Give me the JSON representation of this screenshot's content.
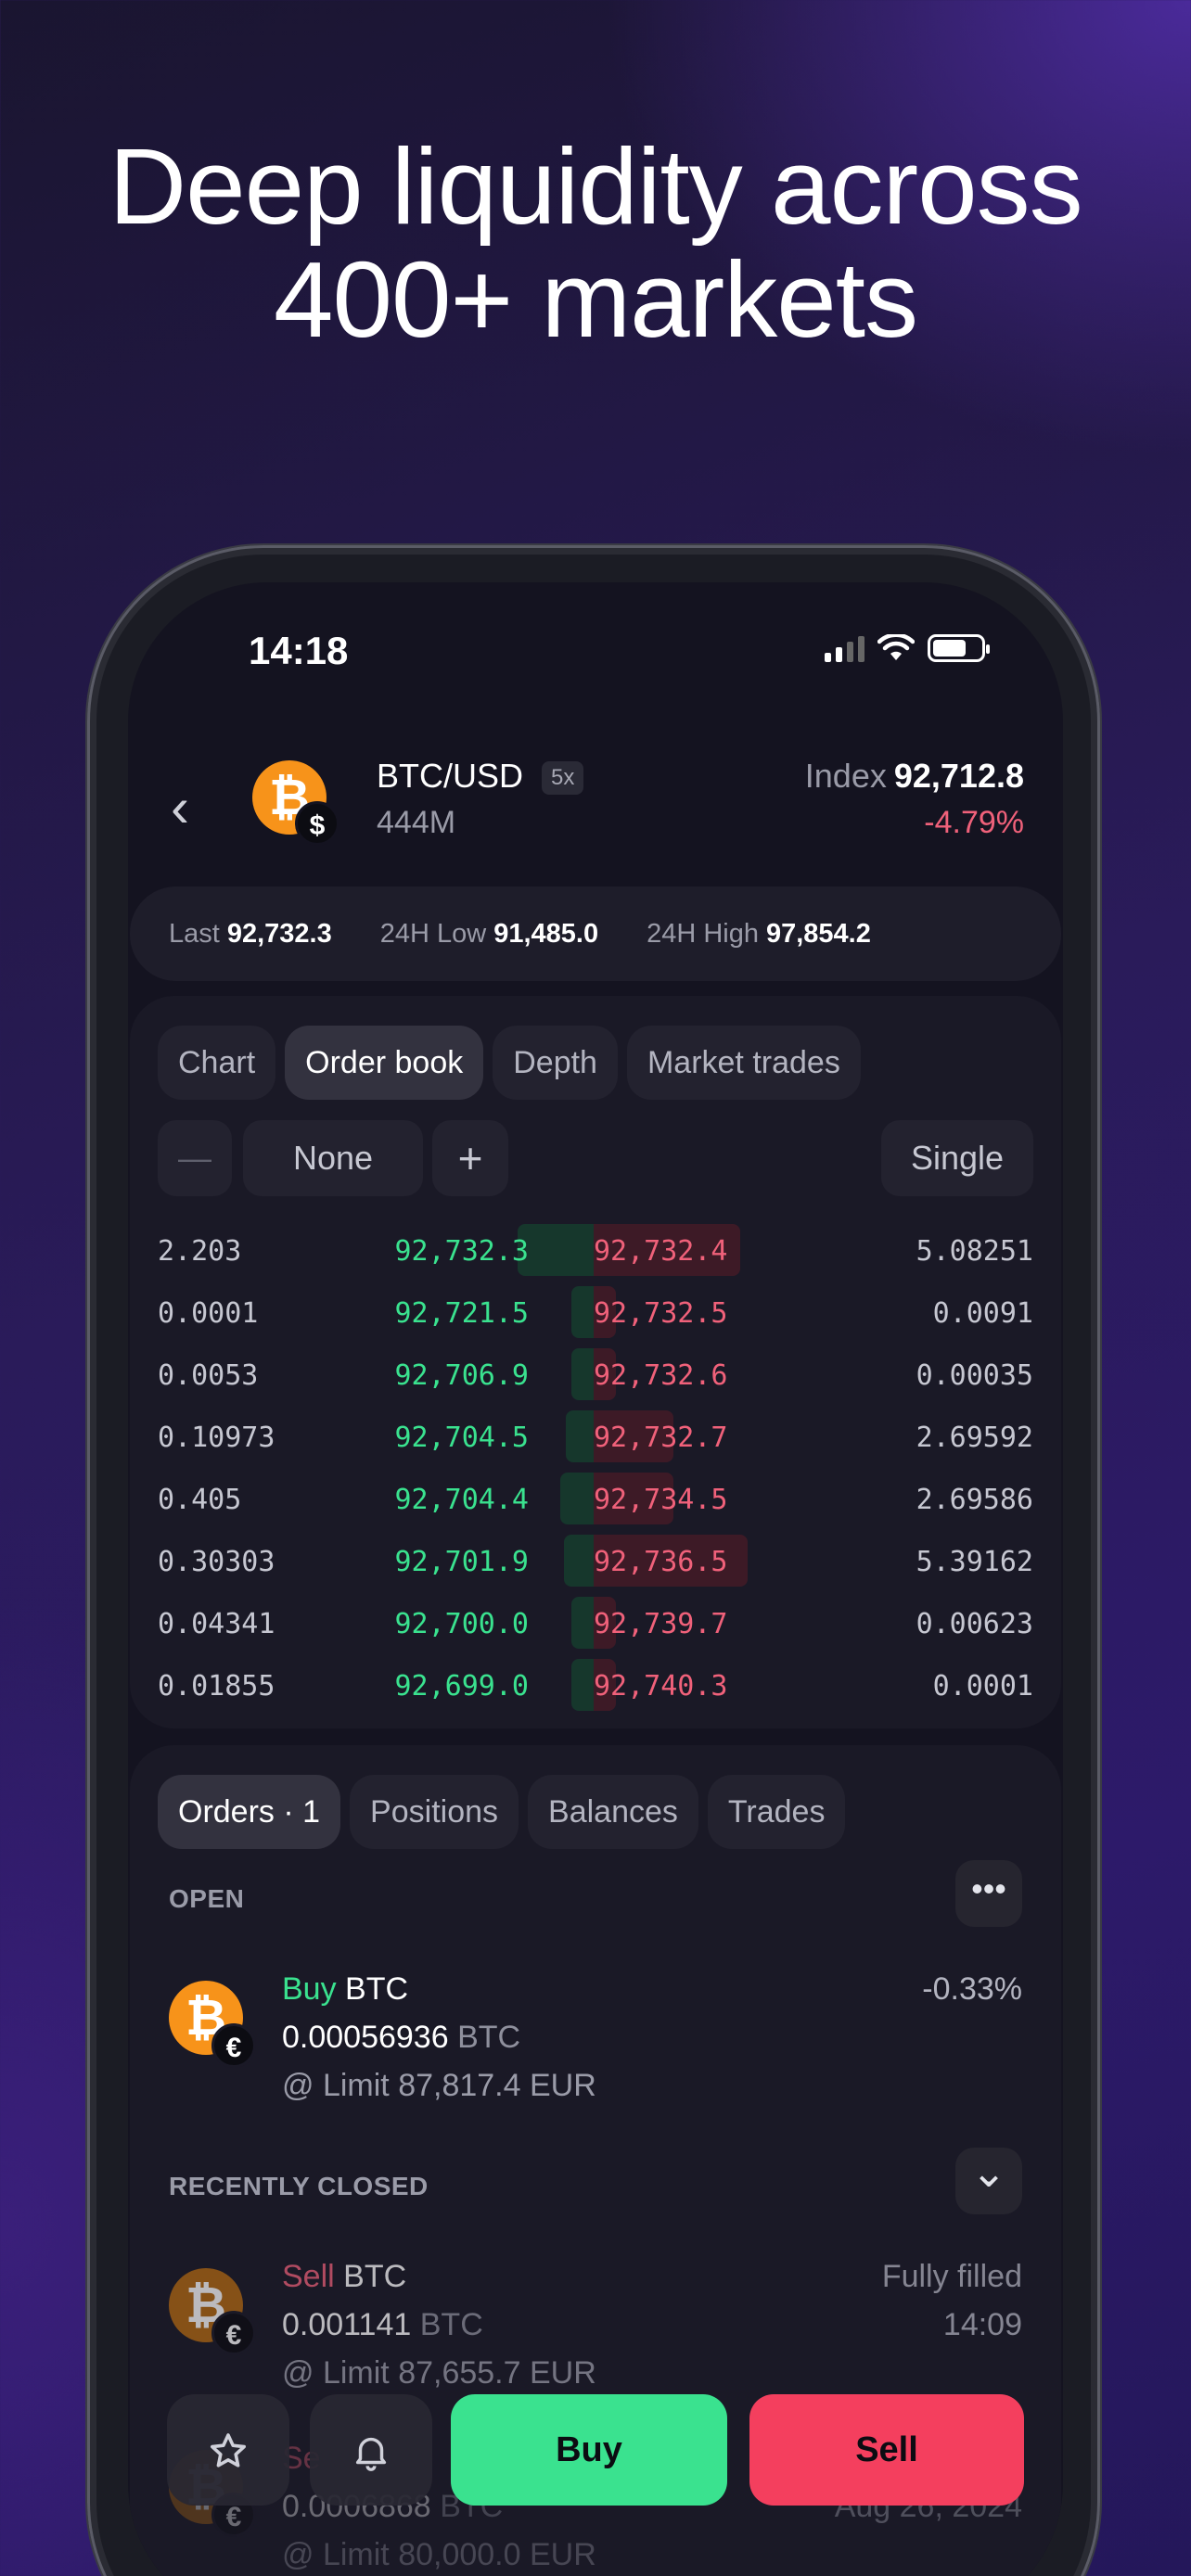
{
  "headline": {
    "line1": "Deep liquidity across",
    "line2": "400+ markets"
  },
  "status_bar": {
    "time": "14:18"
  },
  "header": {
    "back_icon": "chevron-left-icon",
    "coin_symbol": "₿",
    "quote_symbol": "$",
    "pair": "BTC/USD",
    "leverage": "5x",
    "volume": "444M",
    "index_label": "Index",
    "index_value": "92,712.8",
    "change": "-4.79%"
  },
  "stats": {
    "last_label": "Last",
    "last_value": "92,732.3",
    "low_label": "24H Low",
    "low_value": "91,485.0",
    "high_label": "24H High",
    "high_value": "97,854.2"
  },
  "tabs": [
    {
      "label": "Chart",
      "active": false
    },
    {
      "label": "Order book",
      "active": true
    },
    {
      "label": "Depth",
      "active": false
    },
    {
      "label": "Market trades",
      "active": false
    }
  ],
  "controls": {
    "minus": "—",
    "grouping": "None",
    "plus": "+",
    "mode": "Single"
  },
  "order_book": [
    {
      "bid_qty": "2.203",
      "bid": "92,732.3",
      "ask": "92,732.4",
      "ask_qty": "5.08251"
    },
    {
      "bid_qty": "0.0001",
      "bid": "92,721.5",
      "ask": "92,732.5",
      "ask_qty": "0.0091"
    },
    {
      "bid_qty": "0.0053",
      "bid": "92,706.9",
      "ask": "92,732.6",
      "ask_qty": "0.00035"
    },
    {
      "bid_qty": "0.10973",
      "bid": "92,704.5",
      "ask": "92,732.7",
      "ask_qty": "2.69592"
    },
    {
      "bid_qty": "0.405",
      "bid": "92,704.4",
      "ask": "92,734.5",
      "ask_qty": "2.69586"
    },
    {
      "bid_qty": "0.30303",
      "bid": "92,701.9",
      "ask": "92,736.5",
      "ask_qty": "5.39162"
    },
    {
      "bid_qty": "0.04341",
      "bid": "92,700.0",
      "ask": "92,739.7",
      "ask_qty": "0.00623"
    },
    {
      "bid_qty": "0.01855",
      "bid": "92,699.0",
      "ask": "92,740.3",
      "ask_qty": "0.0001"
    }
  ],
  "bottom_tabs": [
    {
      "label": "Orders · 1",
      "active": true
    },
    {
      "label": "Positions",
      "active": false
    },
    {
      "label": "Balances",
      "active": false
    },
    {
      "label": "Trades",
      "active": false
    }
  ],
  "open_section": {
    "label": "OPEN",
    "more_icon": "•••",
    "order": {
      "side": "Buy",
      "asset": "BTC",
      "amount": "0.00056936",
      "unit": "BTC",
      "limit": "@ Limit 87,817.4 EUR",
      "change": "-0.33%",
      "quote_symbol": "€"
    }
  },
  "closed_section": {
    "label": "RECENTLY CLOSED",
    "chevron_icon": "⌄",
    "orders": [
      {
        "side": "Sell",
        "asset": "BTC",
        "amount": "0.001141",
        "unit": "BTC",
        "limit": "@ Limit 87,655.7 EUR",
        "status": "Fully filled",
        "time": "14:09",
        "quote_symbol": "€"
      },
      {
        "side": "Se",
        "asset": "",
        "amount": "0.0006868",
        "unit": "BTC",
        "limit": "@ Limit 80,000.0 EUR",
        "status": "",
        "time": "Aug 26, 2024",
        "quote_symbol": "€"
      }
    ]
  },
  "bottom_bar": {
    "star_icon": "☆",
    "bell_icon": "🔔",
    "buy": "Buy",
    "sell": "Sell"
  }
}
